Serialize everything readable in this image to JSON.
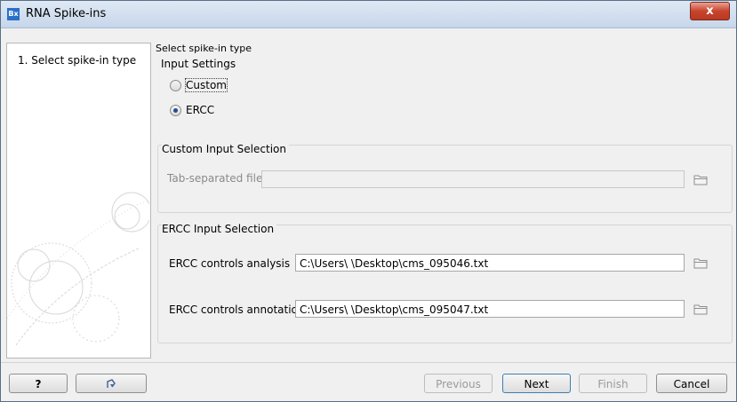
{
  "window": {
    "title": "RNA Spike-ins",
    "app_icon": "Bx",
    "close_glyph": "x"
  },
  "steps": [
    {
      "label": "1.  Select spike-in type"
    }
  ],
  "content": {
    "title": "Select spike-in type",
    "input_settings": {
      "title": "Input Settings",
      "options": [
        {
          "label": "Custom",
          "selected": false
        },
        {
          "label": "ERCC",
          "selected": true
        }
      ]
    },
    "custom_input": {
      "title": "Custom Input Selection",
      "file_label": "Tab-separated file",
      "file_value": ""
    },
    "ercc_input": {
      "title": "ERCC Input Selection",
      "analysis_label": "ERCC controls analysis",
      "analysis_value": "C:\\Users\\             \\Desktop\\cms_095046.txt",
      "annotation_label": "ERCC controls annotation",
      "annotation_value": "C:\\Users\\             \\Desktop\\cms_095047.txt"
    }
  },
  "footer": {
    "help": "?",
    "previous": "Previous",
    "next": "Next",
    "finish": "Finish",
    "cancel": "Cancel"
  }
}
